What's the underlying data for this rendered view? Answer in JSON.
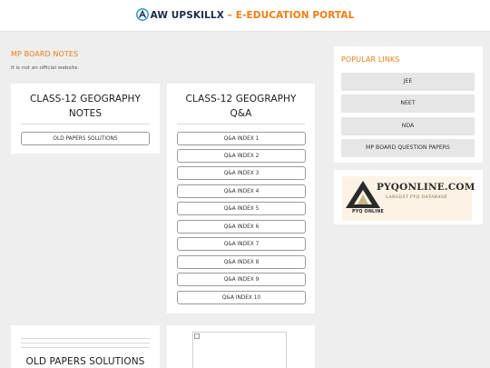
{
  "header": {
    "brand_name": "AW UPSKILLX",
    "separator": "–",
    "brand_tagline": "E-EDUCATION PORTAL"
  },
  "section": {
    "title": "MP BOARD NOTES",
    "disclaimer": "It is not an official website."
  },
  "notes_card": {
    "title": "CLASS-12 GEOGRAPHY NOTES",
    "buttons": [
      "OLD PAPERS SOLUTIONS"
    ]
  },
  "qa_card": {
    "title": "CLASS-12 GEOGRAPHY Q&A",
    "buttons": [
      "Q&A INDEX 1",
      "Q&A INDEX 2",
      "Q&A INDEX 3",
      "Q&A INDEX 4",
      "Q&A INDEX 5",
      "Q&A INDEX 6",
      "Q&A INDEX 7",
      "Q&A INDEX 8",
      "Q&A INDEX 9",
      "Q&A INDEX 10"
    ]
  },
  "old_papers_card": {
    "title": "OLD PAPERS SOLUTIONS"
  },
  "popular_links": {
    "title": "POPULAR LINKS",
    "links": [
      "JEE",
      "NEET",
      "NDA",
      "MP BOARD QUESTION PAPERS"
    ]
  },
  "advert": {
    "title": "PYQONLINE.COM",
    "subtitle": "LARGEST PYQ DATABASE",
    "brand": "PYQ ONLINE"
  },
  "colors": {
    "accent": "#ef7d11",
    "navy": "#1c2a4a",
    "background": "#eeeeee"
  }
}
